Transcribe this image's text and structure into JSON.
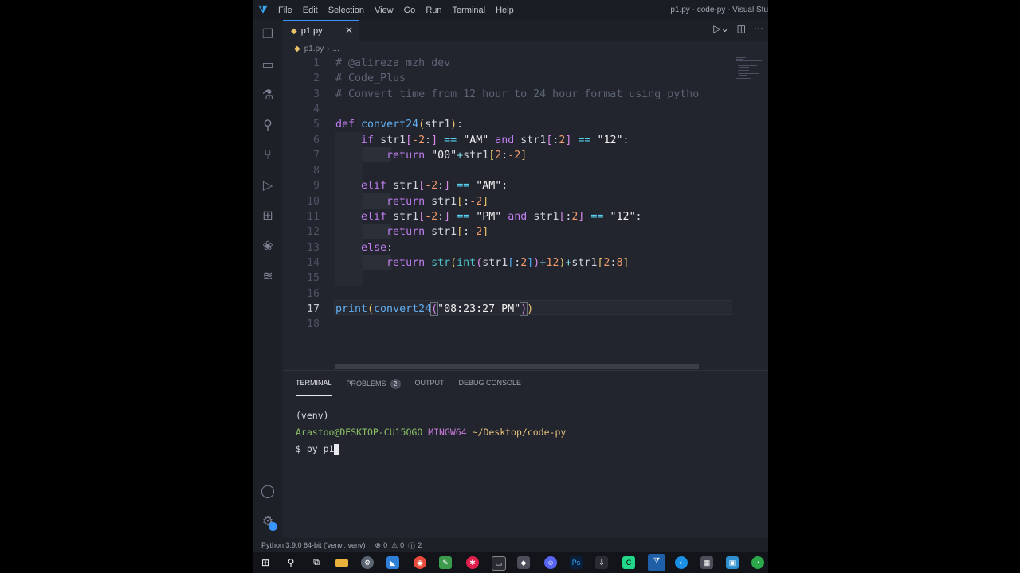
{
  "titlebar": {
    "menu": [
      "File",
      "Edit",
      "Selection",
      "View",
      "Go",
      "Run",
      "Terminal",
      "Help"
    ],
    "window_title": "p1.py - code-py - Visual Stu"
  },
  "tab": {
    "filename": "p1.py"
  },
  "breadcrumb": {
    "file": "p1.py",
    "sep": "›",
    "rest": "..."
  },
  "editor": {
    "line_numbers": [
      "1",
      "2",
      "3",
      "4",
      "5",
      "6",
      "7",
      "8",
      "9",
      "10",
      "11",
      "12",
      "13",
      "14",
      "15",
      "16",
      "17",
      "18"
    ],
    "comment1": "# @alireza_mzh_dev",
    "comment2": "# Code_Plus",
    "comment3": "# Convert time from 12 hour to 24 hour format using pytho"
  },
  "panel": {
    "tabs": [
      "TERMINAL",
      "PROBLEMS",
      "OUTPUT",
      "DEBUG CONSOLE"
    ],
    "problems_count": "2",
    "terminal": {
      "line1": "(venv)",
      "user_host": "Arastoo@DESKTOP-CU15QGO",
      "shell": "MINGW64",
      "path": "~/Desktop/code-py",
      "prompt": "$ py p1"
    }
  },
  "status": {
    "interpreter": "Python 3.9.0 64-bit ('venv': venv)",
    "errors": "0",
    "warnings": "0",
    "info": "2"
  },
  "activity": {
    "badge": "1"
  }
}
